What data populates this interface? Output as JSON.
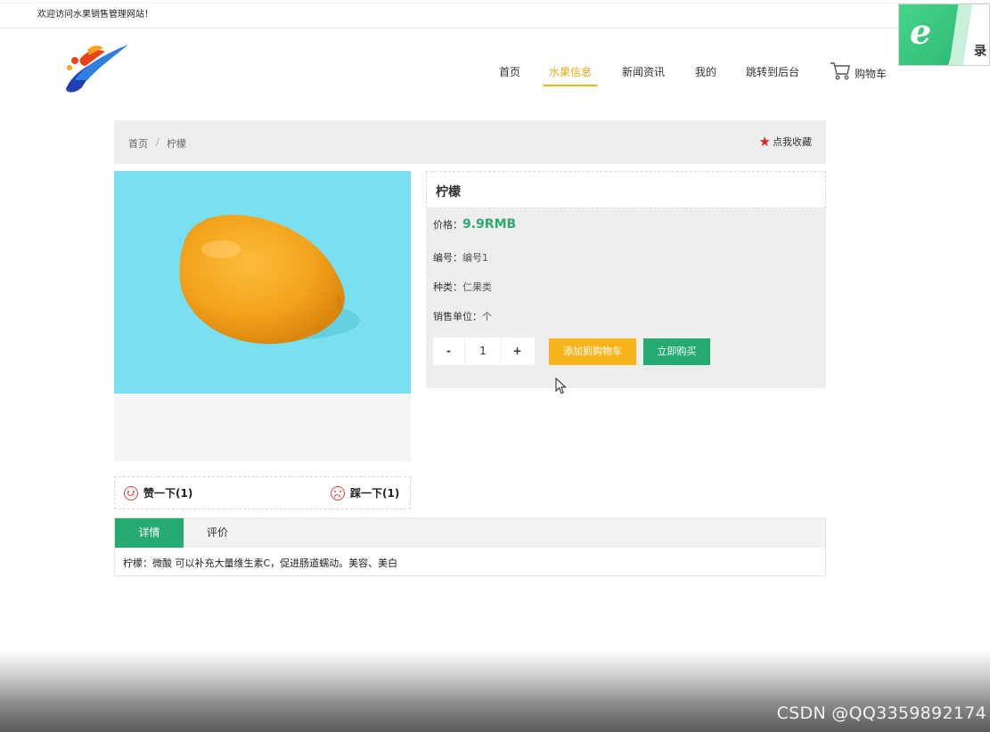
{
  "header": {
    "welcome_text": "欢迎访问水果销售管理网站！",
    "logo_icon": "brand-logo"
  },
  "nav": {
    "items": [
      {
        "label": "首页"
      },
      {
        "label": "水果信息",
        "active": true
      },
      {
        "label": "新闻资讯"
      },
      {
        "label": "我的"
      },
      {
        "label": "跳转到后台"
      }
    ],
    "cart_label": "购物车",
    "cart_icon": "cart-icon",
    "active_color": "#e6a817"
  },
  "overlay_badge": {
    "icon": "ie-browser-icon",
    "text": "录"
  },
  "breadcrumb": {
    "home": "首页",
    "separator": "/",
    "current": "柠檬",
    "favorite_label": "点我收藏",
    "favorite_icon": "star-icon"
  },
  "product": {
    "name": "柠檬",
    "price_label": "价格：",
    "price_value": "9.9RMB",
    "code_label": "编号：",
    "code_value": "编号1",
    "category_label": "种类：",
    "category_value": "仁果类",
    "unit_label": "销售单位：",
    "unit_value": "个",
    "quantity": "1",
    "minus_label": "-",
    "plus_label": "+",
    "add_to_cart_label": "添加到购物车",
    "buy_now_label": "立即购买",
    "image_desc_icon": "lemon-photo"
  },
  "votes": {
    "like_label": "赞一下(1)",
    "dislike_label": "踩一下(1)",
    "like_icon": "smile-icon",
    "dislike_icon": "frown-icon"
  },
  "tabs": {
    "items": [
      {
        "label": "详情",
        "active": true
      },
      {
        "label": "评价"
      }
    ],
    "detail_text": "柠檬：微酸 可以补充大量维生素C，促进肠道蠕动。美容、美白"
  },
  "colors": {
    "primary_green": "#24aa72",
    "accent_yellow": "#f8b41c",
    "price_green": "#2eaa6f",
    "star_red": "#e02020"
  },
  "watermark": "CSDN @QQ3359892174"
}
